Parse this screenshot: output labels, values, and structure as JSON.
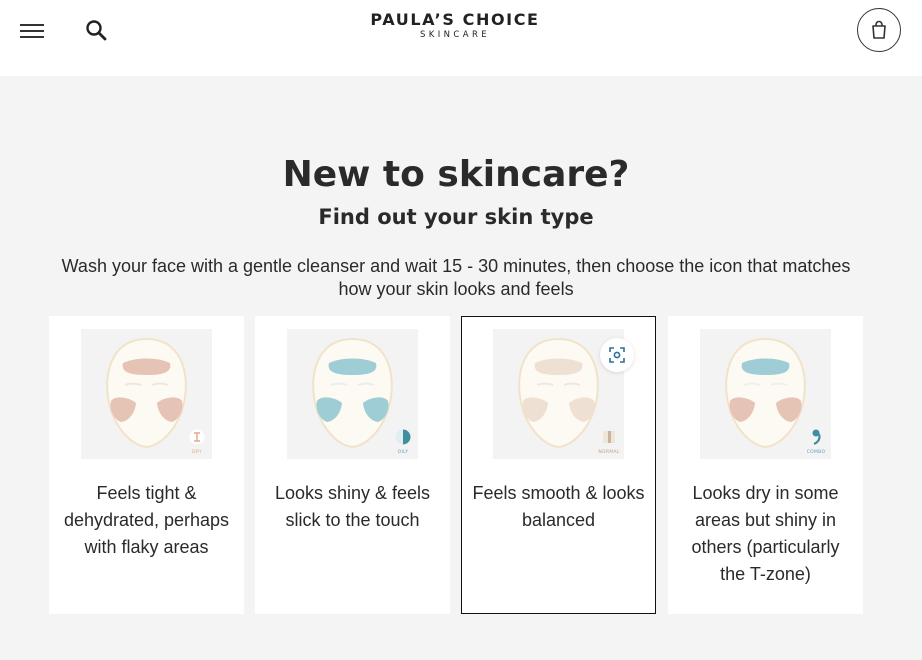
{
  "header": {
    "logo_main": "PAULA’S CHOICE",
    "logo_sub": "SKINCARE"
  },
  "hero": {
    "title": "New to skincare?",
    "subtitle": "Find out your skin type",
    "instructions": "Wash your face with a gentle cleanser and wait 15 - 30 minutes, then choose the icon that matches how your skin looks and feels"
  },
  "cards": [
    {
      "label": "Feels tight & dehydrated, perhaps with flaky areas",
      "badge": "DRY",
      "color": "#e5c3b5",
      "selected": false
    },
    {
      "label": "Looks shiny & feels slick to the touch",
      "badge": "OILY",
      "color": "#9fcdd6",
      "selected": false
    },
    {
      "label": "Feels smooth & looks balanced",
      "badge": "NORMAL",
      "color": "#eee0d2",
      "selected": true
    },
    {
      "label": "Looks dry in some areas but shiny in others (particularly the T-zone)",
      "badge": "COMBO",
      "color_forehead": "#9fcdd6",
      "color_cheeks": "#e5c3b5",
      "selected": false
    }
  ],
  "icons": {
    "menu": "menu-icon",
    "search": "search-icon",
    "cart": "shopping-bag-icon",
    "zoom": "zoom-focus-icon"
  }
}
